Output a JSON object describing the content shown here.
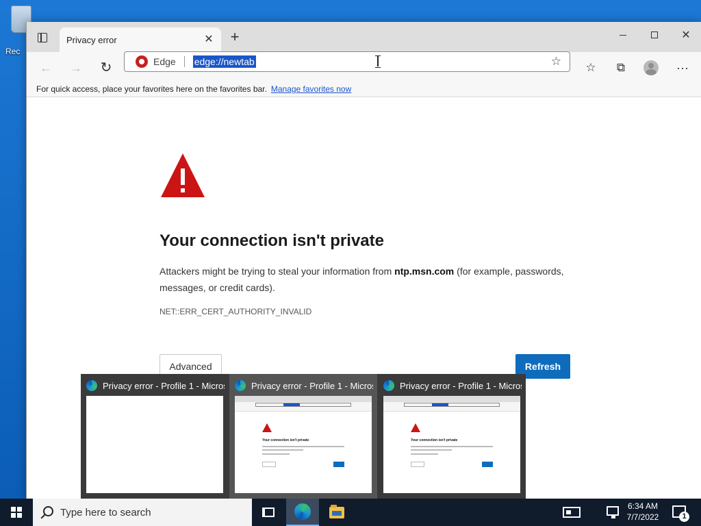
{
  "desktop": {
    "recycle_bin_label": "Rec"
  },
  "browser": {
    "tab": {
      "title": "Privacy error"
    },
    "address": {
      "site_label": "Edge",
      "url": "edge://newtab"
    },
    "favorites_bar": {
      "message": "For quick access, place your favorites here on the favorites bar.",
      "link": "Manage favorites now"
    },
    "page": {
      "title": "Your connection isn't private",
      "desc_prefix": "Attackers might be trying to steal your information from ",
      "desc_host": "ntp.msn.com",
      "desc_suffix": " (for example, passwords, messages, or credit cards).",
      "error_code": "NET::ERR_CERT_AUTHORITY_INVALID",
      "advanced_label": "Advanced",
      "refresh_label": "Refresh"
    }
  },
  "thumbnails": [
    {
      "title": "Privacy error - Profile 1 - Micros...",
      "blank": true
    },
    {
      "title": "Privacy error - Profile 1 - Micros...",
      "blank": false,
      "mini_title": "Your connection isn't private"
    },
    {
      "title": "Privacy error - Profile 1 - Micros...",
      "blank": false,
      "mini_title": "Your connection isn't private"
    }
  ],
  "taskbar": {
    "search_placeholder": "Type here to search",
    "time": "6:34 AM",
    "date": "7/7/2022",
    "notification_count": "1"
  },
  "colors": {
    "accent_blue": "#0f6cbd",
    "warning_red": "#cc1414",
    "selection_blue": "#1a56c8"
  },
  "icons": [
    "recycle-bin-icon",
    "tab-actions-icon",
    "close-icon",
    "plus-icon",
    "minimize-icon",
    "maximize-icon",
    "back-arrow-icon",
    "forward-arrow-icon",
    "refresh-icon",
    "edge-logo-icon",
    "favorite-add-icon",
    "favorites-icon",
    "collections-icon",
    "profile-icon",
    "more-menu-icon",
    "warning-icon",
    "windows-logo-icon",
    "search-icon",
    "task-view-icon",
    "edge-icon",
    "file-explorer-icon",
    "news-icon",
    "network-icon",
    "notification-icon"
  ]
}
